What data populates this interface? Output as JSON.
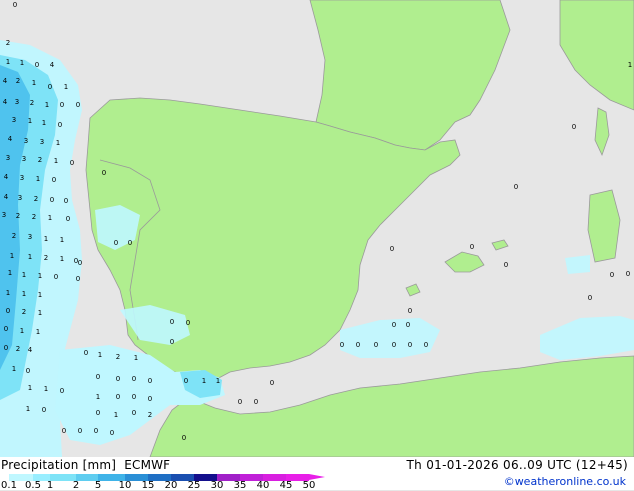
{
  "header": {
    "title": "Precipitation [mm]",
    "model": "ECMWF",
    "date": "Th 01-01-2026 06..09 UTC (12+45)"
  },
  "credit": "©weatheronline.co.uk",
  "legend": {
    "ticks": [
      "0.1",
      "0.5",
      "1",
      "2",
      "5",
      "10",
      "15",
      "20",
      "25",
      "30",
      "35",
      "40",
      "45",
      "50"
    ],
    "colors": [
      "#bff7ff",
      "#99eeff",
      "#7ee3f7",
      "#5fcdf0",
      "#3fb3e8",
      "#2a8fd6",
      "#1f6fc4",
      "#1a4fb0",
      "#140f8c",
      "#a020c8",
      "#c020d8",
      "#d81fe0",
      "#e81fe8"
    ]
  },
  "colors": {
    "sea": "#e6e6e6",
    "land": "#b0ee8f",
    "border": "#9a9a9a",
    "precip_light": "#bff7ff",
    "precip_mid": "#7ee3f7",
    "precip_heavy": "#4fc3ee"
  },
  "map_labels": [
    "0",
    "2",
    "1",
    "1",
    "0",
    "4",
    "4",
    "2",
    "1",
    "0",
    "1",
    "4",
    "3",
    "2",
    "1",
    "0",
    "0",
    "3",
    "1",
    "1",
    "0",
    "4",
    "3",
    "3",
    "1",
    "3",
    "3",
    "2",
    "1",
    "0",
    "4",
    "3",
    "1",
    "0",
    "4",
    "3",
    "2",
    "0",
    "0",
    "3",
    "2",
    "2",
    "1",
    "0",
    "2",
    "3",
    "1",
    "1",
    "1",
    "1",
    "2",
    "1",
    "0",
    "1",
    "1",
    "1",
    "0",
    "1",
    "1",
    "1",
    "0",
    "2",
    "1",
    "0",
    "1",
    "1",
    "0",
    "2",
    "4",
    "1",
    "0",
    "1",
    "1",
    "0",
    "1",
    "0",
    "0",
    "0",
    "0",
    "0",
    "0",
    "0",
    "0",
    "0",
    "0",
    "1",
    "2",
    "1",
    "0",
    "0",
    "0",
    "0",
    "0",
    "0",
    "1",
    "1",
    "1",
    "0",
    "0",
    "0",
    "0",
    "2",
    "1",
    "0",
    "0",
    "0",
    "0",
    "0",
    "0",
    "0",
    "0",
    "0",
    "0",
    "0",
    "0",
    "0",
    "0",
    "0",
    "0",
    "0",
    "0",
    "0",
    "0",
    "0",
    "0",
    "1",
    "0",
    "0",
    "0"
  ]
}
